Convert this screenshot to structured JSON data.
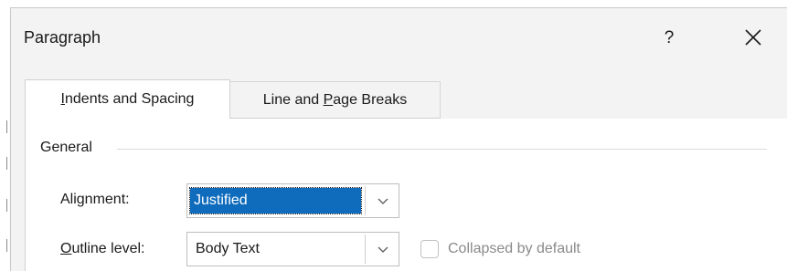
{
  "window": {
    "title": "Paragraph",
    "help_label": "?",
    "close_icon": "close-icon"
  },
  "tabs": [
    {
      "label_pre": "",
      "label_u": "I",
      "label_post": "ndents and Spacing",
      "active": true
    },
    {
      "label_pre": "Line and ",
      "label_u": "P",
      "label_post": "age Breaks",
      "active": false
    }
  ],
  "general": {
    "title": "General",
    "alignment": {
      "label": "Alignment:",
      "value": "Justified"
    },
    "outline_level": {
      "label_u": "O",
      "label_rest": "utline level:",
      "value": "Body Text"
    },
    "collapsed": {
      "label": "Collapsed by default",
      "checked": false,
      "enabled": false
    }
  },
  "colors": {
    "selection": "#0f6cbd",
    "dialog_bg": "#f3f3f3",
    "panel_bg": "#ffffff"
  }
}
